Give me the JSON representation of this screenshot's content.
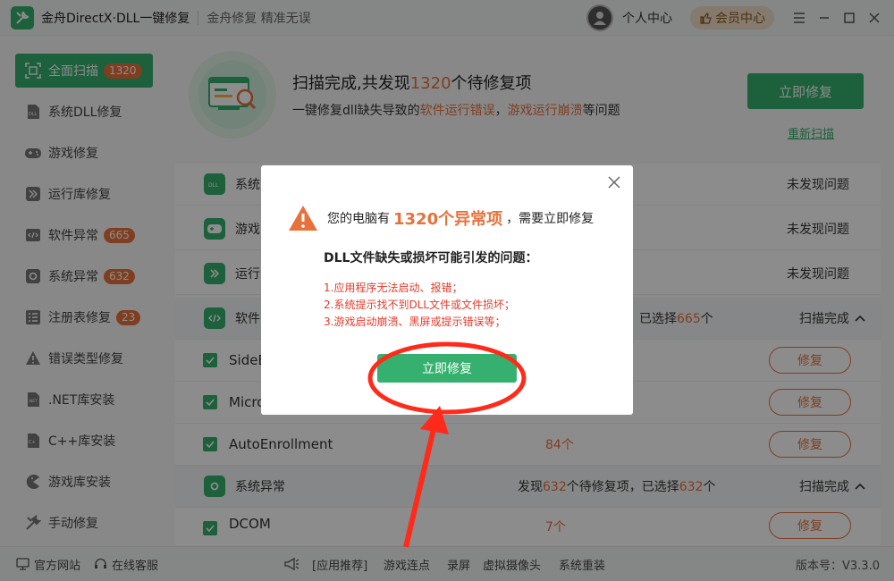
{
  "titlebar": {
    "app_name": "金舟DirectX·DLL一键修复",
    "slogan": "金舟修复 精准无误",
    "user_center": "个人中心",
    "vip": "会员中心"
  },
  "sidebar": {
    "items": [
      {
        "label": "全面扫描",
        "badge": "1320",
        "icon": "scan-icon"
      },
      {
        "label": "系统DLL修复",
        "badge": "",
        "icon": "dll-icon"
      },
      {
        "label": "游戏修复",
        "badge": "",
        "icon": "gamepad-icon"
      },
      {
        "label": "运行库修复",
        "badge": "",
        "icon": "runtime-icon"
      },
      {
        "label": "软件异常",
        "badge": "665",
        "icon": "code-icon"
      },
      {
        "label": "系统异常",
        "badge": "632",
        "icon": "gear-icon"
      },
      {
        "label": "注册表修复",
        "badge": "23",
        "icon": "registry-icon"
      },
      {
        "label": "错误类型修复",
        "badge": "",
        "icon": "warning-icon"
      },
      {
        "label": ".NET库安装",
        "badge": "",
        "icon": "dotnet-icon"
      },
      {
        "label": "C++库安装",
        "badge": "",
        "icon": "cpp-icon"
      },
      {
        "label": "游戏库安装",
        "badge": "",
        "icon": "pacman-icon"
      },
      {
        "label": "手动修复",
        "badge": "",
        "icon": "tools-icon"
      }
    ]
  },
  "hero": {
    "title_pre": "扫描完成,共发现",
    "title_num": "1320",
    "title_post": "个待修复项",
    "sub_pre": "一键修复dll缺失导致的",
    "sub_warn1": "软件运行错误",
    "sub_mid": "，",
    "sub_warn2": "游戏运行崩溃",
    "sub_post": "等问题",
    "fix_now": "立即修复",
    "rescan": "重新扫描"
  },
  "list": {
    "rows": [
      {
        "name": "系统",
        "status": "未发现问题"
      },
      {
        "name": "游戏",
        "status": "未发现问题"
      },
      {
        "name": "运行",
        "status": "未发现问题"
      },
      {
        "name": "软件",
        "selected_pre": "已选择",
        "selected_num": "665",
        "selected_post": "个",
        "done": "扫描完成"
      },
      {
        "name": "SideB",
        "repair": "修复"
      },
      {
        "name": "Micro",
        "repair": "修复"
      },
      {
        "name": "AutoEnrollment",
        "count": "84个",
        "repair": "修复"
      },
      {
        "name": "系统异常",
        "found_pre": "发现",
        "found_num": "632",
        "found_mid": "个待修复项，已选择",
        "found_num2": "632",
        "found_post": "个",
        "done": "扫描完成"
      },
      {
        "name": "DCOM",
        "count": "7个",
        "repair": "修复"
      }
    ]
  },
  "modal": {
    "title_pre": "您的电脑有",
    "title_big": "1320个异常项",
    "title_post": "，需要立即修复",
    "subtitle": "DLL文件缺失或损坏可能引发的问题：",
    "issues": [
      "1.应用程序无法启动、报错；",
      "2.系统提示找不到DLL文件或文件损坏；",
      "3.游戏启动崩溃、黑屏或提示错误等；"
    ],
    "button": "立即修复"
  },
  "footer": {
    "website": "官方网站",
    "support": "在线客服",
    "recommend": "[应用推荐]",
    "links": [
      "游戏连点",
      "录屏",
      "虚拟摄像头",
      "系统重装"
    ],
    "version": "版本号：V3.3.0"
  },
  "colors": {
    "accent": "#35b06e",
    "warning": "#e8713b",
    "error": "#e53a2b"
  }
}
